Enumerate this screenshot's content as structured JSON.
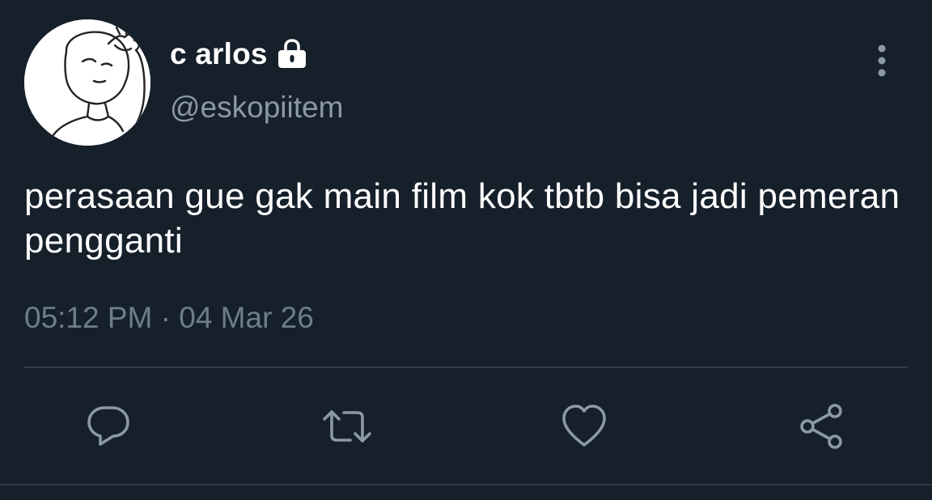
{
  "user": {
    "display_name": "c arlos",
    "handle": "@eskopiitem",
    "protected_icon": "lock-icon",
    "avatar_icon": "facepalm-meme-avatar"
  },
  "tweet": {
    "text": "perasaan gue gak main film kok tbtb bisa jadi pemeran pengganti",
    "timestamp": "05:12 PM · 04 Mar 26"
  },
  "actions": [
    {
      "name": "reply",
      "icon": "reply-icon"
    },
    {
      "name": "retweet",
      "icon": "retweet-icon"
    },
    {
      "name": "like",
      "icon": "heart-icon"
    },
    {
      "name": "share",
      "icon": "share-icon"
    }
  ],
  "menu": {
    "icon": "more-vertical-icon"
  },
  "colors": {
    "background": "#16202b",
    "primary_text": "#ffffff",
    "secondary_text": "#8b98a5",
    "timestamp_text": "#6e7d8c",
    "icon": "#8b98a5",
    "divider": "#2f3b47"
  }
}
